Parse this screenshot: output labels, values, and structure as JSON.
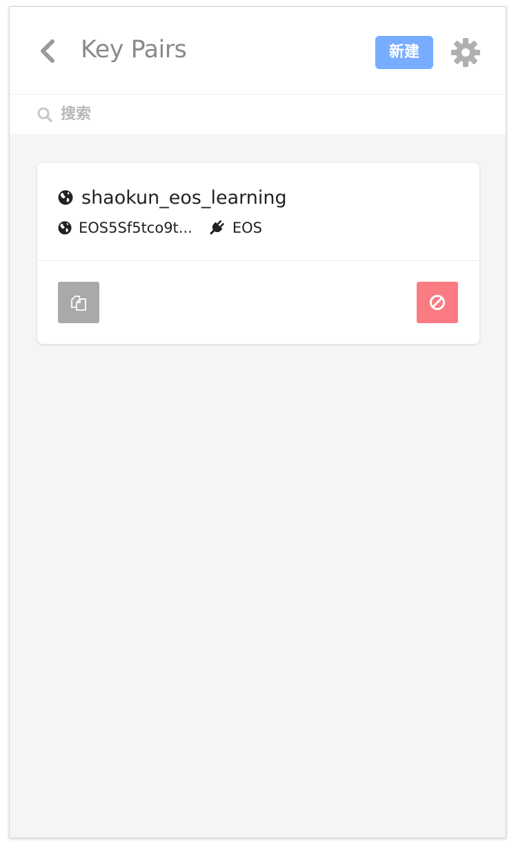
{
  "header": {
    "title": "Key Pairs",
    "new_label": "新建",
    "back_icon": "chevron-left-icon",
    "settings_icon": "gear-icon"
  },
  "search": {
    "placeholder": "搜索",
    "value": "",
    "icon": "search-icon"
  },
  "keypairs": [
    {
      "name": "shaokun_eos_learning",
      "public_key": "EOS5Sf5tco9t...",
      "blockchain": "EOS",
      "name_icon": "globe-icon",
      "key_icon": "globe-icon",
      "chain_icon": "plug-icon",
      "actions": [
        {
          "name": "copy",
          "icon": "copy-icon",
          "color": "#a9a9a9"
        },
        {
          "name": "remove",
          "icon": "ban-icon",
          "color": "#fa7b82"
        }
      ]
    }
  ],
  "colors": {
    "accent": "#78acff",
    "danger": "#fa7b82",
    "neutral": "#a9a9a9",
    "background": "#f5f5f5"
  }
}
